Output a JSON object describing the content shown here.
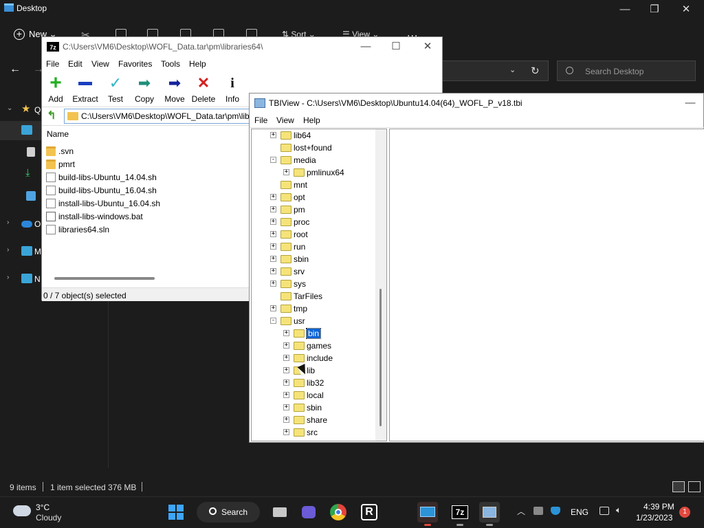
{
  "explorer": {
    "title": "Desktop",
    "toolbar": {
      "new_label": "New",
      "sort_label": "Sort",
      "view_label": "View",
      "more_label": "..."
    },
    "search_placeholder": "Search Desktop",
    "nav": [
      {
        "label": "Q",
        "chevron": "⌄",
        "icon": "star-icon",
        "color": "#f2c350"
      },
      {
        "label": "O",
        "chevron": "›",
        "icon": "cloud-icon",
        "color": "#2b86d9"
      },
      {
        "label": "M",
        "chevron": "›",
        "icon": "monitor-icon",
        "color": "#3aa4d8"
      },
      {
        "label": "N",
        "chevron": "›",
        "icon": "network-icon",
        "color": "#3aa4d8"
      }
    ],
    "status": {
      "items": "9 items",
      "selected": "1 item selected  376 MB"
    }
  },
  "sevenzip": {
    "title": "C:\\Users\\VM6\\Desktop\\WOFL_Data.tar\\pm\\libraries64\\",
    "logo": "7z",
    "menu": [
      "File",
      "Edit",
      "View",
      "Favorites",
      "Tools",
      "Help"
    ],
    "toolbar": [
      {
        "label": "Add",
        "icon": "add-icon",
        "color": "#22b022"
      },
      {
        "label": "Extract",
        "icon": "extract-icon",
        "color": "#1a3fbf"
      },
      {
        "label": "Test",
        "icon": "test-icon",
        "color": "#2fb3c9"
      },
      {
        "label": "Copy",
        "icon": "copy-icon",
        "color": "#1f8f7a"
      },
      {
        "label": "Move",
        "icon": "move-icon",
        "color": "#15229a"
      },
      {
        "label": "Delete",
        "icon": "delete-icon",
        "color": "#d41f1f"
      },
      {
        "label": "Info",
        "icon": "info-icon",
        "color": "#e7c100"
      }
    ],
    "path": "C:\\Users\\VM6\\Desktop\\WOFL_Data.tar\\pm\\libraries64\\",
    "column_header": "Name",
    "files": [
      {
        "name": ".svn",
        "type": "folder"
      },
      {
        "name": "pmrt",
        "type": "folder"
      },
      {
        "name": "build-libs-Ubuntu_14.04.sh",
        "type": "file"
      },
      {
        "name": "build-libs-Ubuntu_16.04.sh",
        "type": "file"
      },
      {
        "name": "install-libs-Ubuntu_16.04.sh",
        "type": "file"
      },
      {
        "name": "install-libs-windows.bat",
        "type": "bat"
      },
      {
        "name": "libraries64.sln",
        "type": "file"
      }
    ],
    "status": "0 / 7 object(s) selected"
  },
  "tbiview": {
    "title": "TBIView - C:\\Users\\VM6\\Desktop\\Ubuntu14.04(64)_WOFL_P_v18.tbi",
    "menu": [
      "File",
      "View",
      "Help"
    ],
    "tree": [
      {
        "label": "lib64",
        "level": 0,
        "expander": "+"
      },
      {
        "label": "lost+found",
        "level": 0,
        "expander": ""
      },
      {
        "label": "media",
        "level": 0,
        "expander": "-"
      },
      {
        "label": "pmlinux64",
        "level": 1,
        "expander": "+"
      },
      {
        "label": "mnt",
        "level": 0,
        "expander": ""
      },
      {
        "label": "opt",
        "level": 0,
        "expander": "+"
      },
      {
        "label": "pm",
        "level": 0,
        "expander": "+"
      },
      {
        "label": "proc",
        "level": 0,
        "expander": "+"
      },
      {
        "label": "root",
        "level": 0,
        "expander": "+"
      },
      {
        "label": "run",
        "level": 0,
        "expander": "+"
      },
      {
        "label": "sbin",
        "level": 0,
        "expander": "+"
      },
      {
        "label": "srv",
        "level": 0,
        "expander": "+"
      },
      {
        "label": "sys",
        "level": 0,
        "expander": "+"
      },
      {
        "label": "TarFiles",
        "level": 0,
        "expander": ""
      },
      {
        "label": "tmp",
        "level": 0,
        "expander": "+"
      },
      {
        "label": "usr",
        "level": 0,
        "expander": "-"
      },
      {
        "label": "bin",
        "level": 1,
        "expander": "+",
        "selected": true
      },
      {
        "label": "games",
        "level": 1,
        "expander": "+"
      },
      {
        "label": "include",
        "level": 1,
        "expander": "+"
      },
      {
        "label": "lib",
        "level": 1,
        "expander": "+"
      },
      {
        "label": "lib32",
        "level": 1,
        "expander": "+"
      },
      {
        "label": "local",
        "level": 1,
        "expander": "+"
      },
      {
        "label": "sbin",
        "level": 1,
        "expander": "+"
      },
      {
        "label": "share",
        "level": 1,
        "expander": "+"
      },
      {
        "label": "src",
        "level": 1,
        "expander": "+"
      }
    ]
  },
  "taskbar": {
    "weather": {
      "temp": "3°C",
      "condition": "Cloudy"
    },
    "search_label": "Search",
    "apps": [
      {
        "name": "task-view-icon",
        "color": "#c8c8c8"
      },
      {
        "name": "meet-icon",
        "color": "#6b5bd6"
      },
      {
        "name": "chrome-icon",
        "color": "#e5433c"
      },
      {
        "name": "rstudio-icon",
        "color": "#ffffff"
      },
      {
        "name": "remote-desktop-icon",
        "color": "#2b93d6"
      },
      {
        "name": "7zip-icon",
        "color": "#000000"
      },
      {
        "name": "tbiview-icon",
        "color": "#8ab6e0"
      }
    ],
    "language": "ENG",
    "time": "4:39 PM",
    "date": "1/23/2023",
    "notification_count": "1"
  }
}
